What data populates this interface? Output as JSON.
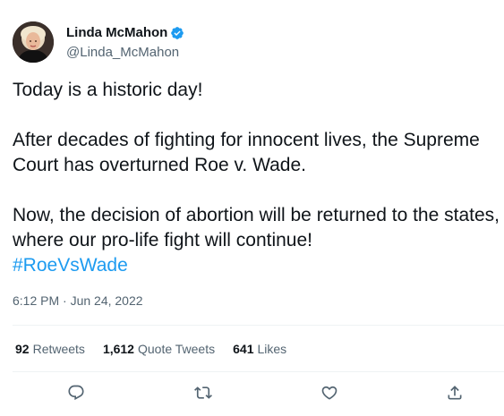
{
  "author": {
    "display_name": "Linda McMahon",
    "handle": "@Linda_McMahon",
    "verified": true,
    "avatar": "avatar-photo"
  },
  "tweet": {
    "line1": "Today is a historic day!",
    "para2": "After decades of fighting for innocent lives, the Supreme Court has overturned Roe v. Wade.",
    "para3": "Now, the decision of abortion will be returned to the states, where our pro-life fight will continue!",
    "hashtag": "#RoeVsWade",
    "timestamp": "6:12 PM · Jun 24, 2022"
  },
  "stats": {
    "retweets_count": "92",
    "retweets_label": "Retweets",
    "quotes_count": "1,612",
    "quotes_label": "Quote Tweets",
    "likes_count": "641",
    "likes_label": "Likes"
  },
  "actions": [
    "reply-icon",
    "retweet-icon",
    "like-icon",
    "share-icon"
  ],
  "colors": {
    "text": "#0f1419",
    "secondary": "#536471",
    "accent": "#1d9bf0",
    "divider": "#eff3f4"
  }
}
